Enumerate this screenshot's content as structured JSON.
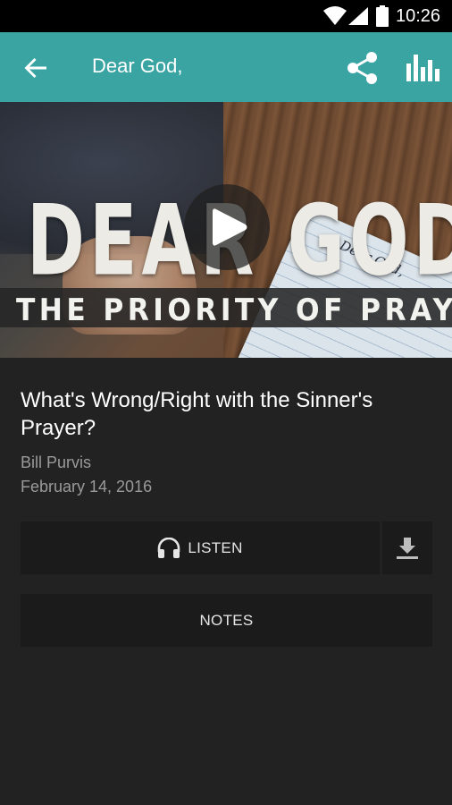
{
  "status_bar": {
    "time": "10:26"
  },
  "app_bar": {
    "title": "Dear God,"
  },
  "hero": {
    "series_title": "DEAR GOD,",
    "series_subtitle": "THE PRIORITY OF PRAYER",
    "paper_text": "Dear God,"
  },
  "episode": {
    "title": "What's Wrong/Right with the Sinner's Prayer?",
    "speaker": "Bill Purvis",
    "date": "February 14, 2016"
  },
  "actions": {
    "listen_label": "LISTEN",
    "notes_label": "NOTES"
  },
  "colors": {
    "accent": "#3aa4a3",
    "background": "#222222",
    "button_bg": "#1b1b1b",
    "secondary_text": "#9a9a9a"
  },
  "icons": [
    "wifi-icon",
    "signal-icon",
    "battery-icon",
    "back-arrow-icon",
    "share-icon",
    "stats-icon",
    "play-icon",
    "headphones-icon",
    "download-icon"
  ]
}
